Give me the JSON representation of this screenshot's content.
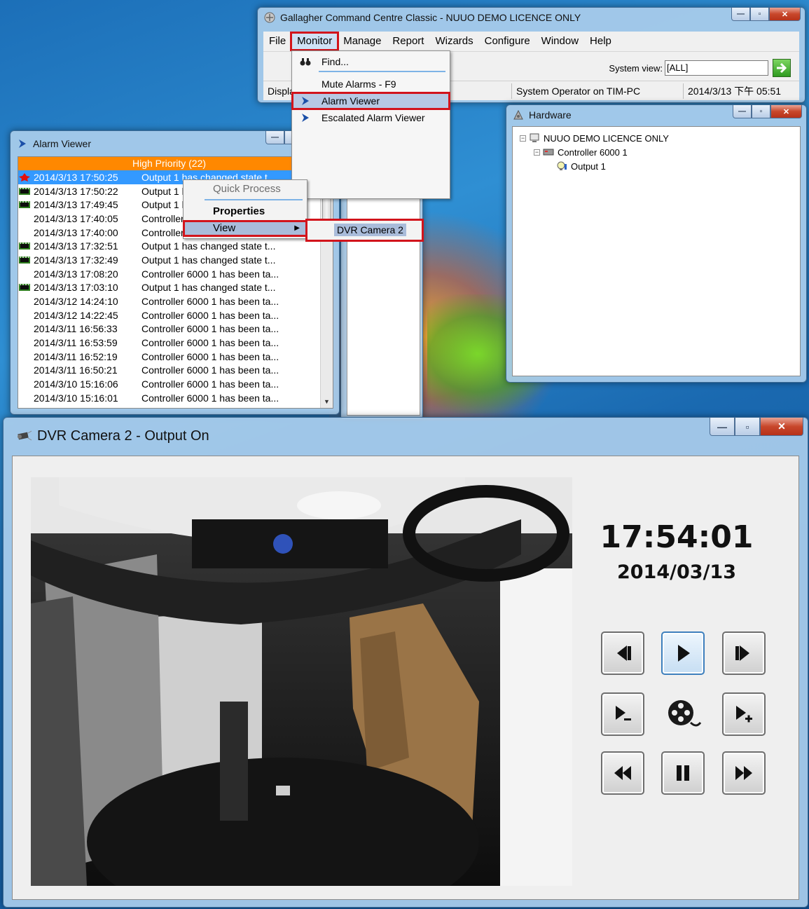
{
  "main_window": {
    "title": "Gallagher Command Centre Classic - NUUO DEMO LICENCE ONLY",
    "menu": [
      "File",
      "Monitor",
      "Manage",
      "Report",
      "Wizards",
      "Configure",
      "Window",
      "Help"
    ],
    "system_view_label": "System view:",
    "system_view_value": "[ALL]",
    "status": {
      "display": "Displa",
      "operator": "System Operator on TIM-PC",
      "datetime": "2014/3/13 下午 05:51"
    }
  },
  "monitor_menu": {
    "find": "Find...",
    "mute": "Mute Alarms - F9",
    "alarm_viewer": "Alarm Viewer",
    "escalated": "Escalated Alarm Viewer",
    "partial": "er"
  },
  "hardware_window": {
    "title": "Hardware",
    "tree": {
      "root": "NUUO DEMO LICENCE ONLY",
      "controller": "Controller 6000 1",
      "output": "Output 1"
    }
  },
  "alarm_viewer": {
    "title": "Alarm Viewer",
    "header": "High Priority (22)",
    "rows": [
      {
        "icon": "red",
        "time": "2014/3/13 17:50:25",
        "desc": "Output 1 has changed state t..."
      },
      {
        "icon": "film",
        "time": "2014/3/13 17:50:22",
        "desc": "Output 1 has changed state t..."
      },
      {
        "icon": "film",
        "time": "2014/3/13 17:49:45",
        "desc": "Output 1 has changed state t..."
      },
      {
        "icon": "",
        "time": "2014/3/13 17:40:05",
        "desc": "Controller 6000 1 has been ta..."
      },
      {
        "icon": "",
        "time": "2014/3/13 17:40:00",
        "desc": "Controller 6000 1 has been ta..."
      },
      {
        "icon": "film",
        "time": "2014/3/13 17:32:51",
        "desc": "Output 1 has changed state t..."
      },
      {
        "icon": "film",
        "time": "2014/3/13 17:32:49",
        "desc": "Output 1 has changed state t..."
      },
      {
        "icon": "",
        "time": "2014/3/13 17:08:20",
        "desc": "Controller 6000 1 has been ta..."
      },
      {
        "icon": "film",
        "time": "2014/3/13 17:03:10",
        "desc": "Output 1 has changed state t..."
      },
      {
        "icon": "",
        "time": "2014/3/12 14:24:10",
        "desc": "Controller 6000 1 has been ta..."
      },
      {
        "icon": "",
        "time": "2014/3/12 14:22:45",
        "desc": "Controller 6000 1 has been ta..."
      },
      {
        "icon": "",
        "time": "2014/3/11 16:56:33",
        "desc": "Controller 6000 1 has been ta..."
      },
      {
        "icon": "",
        "time": "2014/3/11 16:53:59",
        "desc": "Controller 6000 1 has been ta..."
      },
      {
        "icon": "",
        "time": "2014/3/11 16:52:19",
        "desc": "Controller 6000 1 has been ta..."
      },
      {
        "icon": "",
        "time": "2014/3/11 16:50:21",
        "desc": "Controller 6000 1 has been ta..."
      },
      {
        "icon": "",
        "time": "2014/3/10 15:16:06",
        "desc": "Controller 6000 1 has been ta..."
      },
      {
        "icon": "",
        "time": "2014/3/10 15:16:01",
        "desc": "Controller 6000 1 has been ta..."
      }
    ]
  },
  "context_menu": {
    "quick_process": "Quick Process",
    "properties": "Properties",
    "view": "View",
    "submenu_item": "DVR Camera 2"
  },
  "dvr_window": {
    "title": "DVR Camera 2 - Output On",
    "time": "17:54:01",
    "date": "2014/03/13"
  },
  "colors": {
    "highlight_red": "#d2141c",
    "priority_orange": "#ff8800",
    "selection_blue": "#3399ff"
  }
}
